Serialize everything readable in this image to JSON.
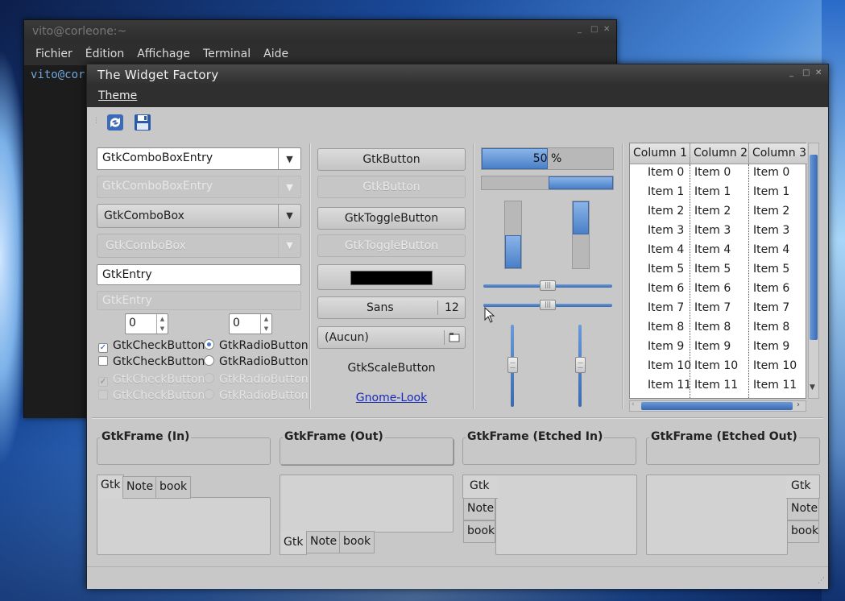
{
  "terminal": {
    "title": "vito@corleone:~",
    "menu": [
      "Fichier",
      "Édition",
      "Affichage",
      "Terminal",
      "Aide"
    ],
    "prompt": "vito@cor"
  },
  "window": {
    "title": "The Widget Factory",
    "menu_theme": "Theme"
  },
  "col1": {
    "combo_entry": "GtkComboBoxEntry",
    "combo_entry_dis": "GtkComboBoxEntry",
    "combo": "GtkComboBox",
    "combo_dis": "GtkComboBox",
    "entry": "GtkEntry",
    "entry_dis": "GtkEntry",
    "spin1": "0",
    "spin2": "0",
    "check": "GtkCheckButton",
    "radio": "GtkRadioButton",
    "check2": "GtkCheckButton",
    "radio2": "GtkRadioButton",
    "check_dis": "GtkCheckButton",
    "radio_dis": "GtkRadioButton",
    "check_dis2": "GtkCheckButton",
    "radio_dis2": "GtkRadioButton"
  },
  "col2": {
    "button": "GtkButton",
    "button_dis": "GtkButton",
    "toggle": "GtkToggleButton",
    "toggle_dis": "GtkToggleButton",
    "color": "#000000",
    "font_name": "Sans",
    "font_size": "12",
    "file_chooser": "(Aucun)",
    "scale_button": "GtkScaleButton",
    "link": "Gnome-Look"
  },
  "col3": {
    "progress_value": 0.5,
    "progress_label": "50 %"
  },
  "tree": {
    "headers": [
      "Column 1",
      "Column 2",
      "Column 3"
    ],
    "rows": [
      [
        "Item 0",
        "Item 0",
        "Item 0"
      ],
      [
        "Item 1",
        "Item 1",
        "Item 1"
      ],
      [
        "Item 2",
        "Item 2",
        "Item 2"
      ],
      [
        "Item 3",
        "Item 3",
        "Item 3"
      ],
      [
        "Item 4",
        "Item 4",
        "Item 4"
      ],
      [
        "Item 5",
        "Item 5",
        "Item 5"
      ],
      [
        "Item 6",
        "Item 6",
        "Item 6"
      ],
      [
        "Item 7",
        "Item 7",
        "Item 7"
      ],
      [
        "Item 8",
        "Item 8",
        "Item 8"
      ],
      [
        "Item 9",
        "Item 9",
        "Item 9"
      ],
      [
        "Item 10",
        "Item 10",
        "Item 10"
      ],
      [
        "Item 11",
        "Item 11",
        "Item 11"
      ]
    ]
  },
  "frames": {
    "in": "GtkFrame (In)",
    "out": "GtkFrame (Out)",
    "etched_in": "GtkFrame (Etched In)",
    "etched_out": "GtkFrame (Etched Out)"
  },
  "notebook_tabs": [
    "Gtk",
    "Note",
    "book"
  ]
}
